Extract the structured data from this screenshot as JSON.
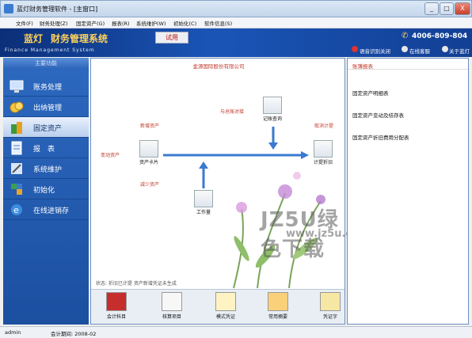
{
  "window": {
    "title": "蓝灯财务管理软件 - [主窗口]",
    "buttons": [
      "_",
      "□",
      "X"
    ]
  },
  "menu": [
    "文件(F)",
    "财务处理(Z)",
    "固定资产(G)",
    "报表(R)",
    "系统维护(W)",
    "初始化(C)",
    "软件信息(S)"
  ],
  "header": {
    "brand_name": "蓝灯",
    "brand_product": "财务管理系统",
    "trial": "试用",
    "subtitle": "Finance Management System",
    "hotline": "4006-809-804",
    "links": [
      "语音识别关闭",
      "在线客服",
      "关于蓝灯"
    ]
  },
  "sidebar": {
    "title": "主要功能",
    "items": [
      {
        "label": "账务处理",
        "icon": "monitor-icon"
      },
      {
        "label": "出纳管理",
        "icon": "coins-icon"
      },
      {
        "label": "固定资产",
        "icon": "building-icon",
        "active": true
      },
      {
        "label": "报　表",
        "icon": "report-icon"
      },
      {
        "label": "系统维护",
        "icon": "tools-icon"
      },
      {
        "label": "初始化",
        "icon": "puzzle-icon"
      },
      {
        "label": "在线进销存",
        "icon": "ie-icon"
      }
    ]
  },
  "main": {
    "company": "金源国际股份有限公司",
    "tools": {
      "ledger": "记账查询",
      "asset_card": "资产卡片",
      "depreciation": "计提折旧",
      "workload": "工作量"
    },
    "labels": {
      "voucher_link": "与总账对接",
      "add_asset": "新增资产",
      "change_asset": "变动资产",
      "reduce_asset": "减少资产",
      "cancel_depr": "取消计提"
    },
    "status": "状态: 折旧已计提  资产新增凭证未生成",
    "toolbar": [
      "会计科目",
      "核算项目",
      "模式凭证",
      "常用摘要",
      "凭证字"
    ],
    "watermark": "JZ5U绿色下载",
    "watermark_url": "www.jz5u.com"
  },
  "right": {
    "title": "账簿报表",
    "reports": [
      "固定资产明细表",
      "固定资产变动及结存表",
      "固定资产折旧费用分配表"
    ]
  },
  "statusbar": {
    "user": "admin",
    "period_label": "会计期间: 2008-02"
  }
}
